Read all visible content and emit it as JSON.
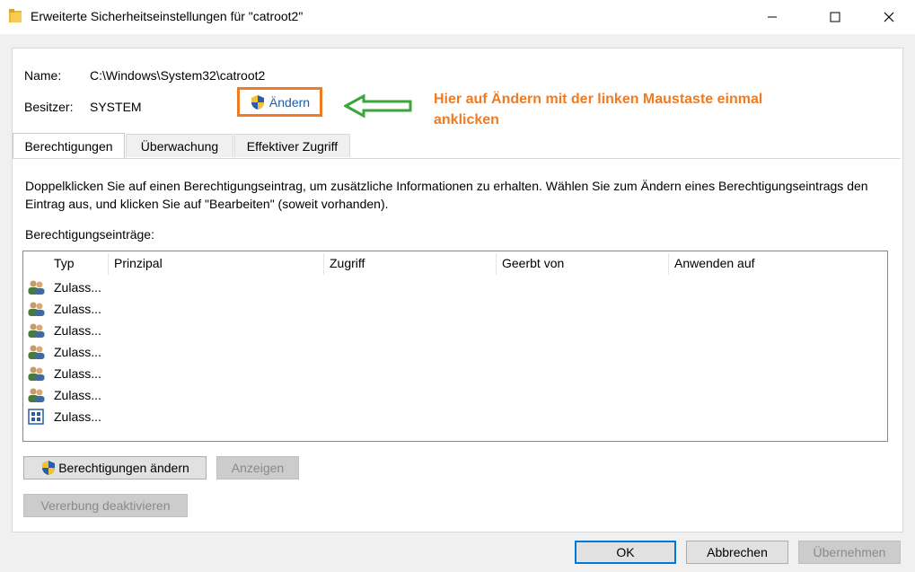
{
  "window": {
    "title": "Erweiterte Sicherheitseinstellungen für \"catroot2\"",
    "icons": [
      "folder-icon",
      "minimize-icon",
      "maximize-icon",
      "close-icon"
    ]
  },
  "owner_section": {
    "name_label": "Name:",
    "name_value": "C:\\Windows\\System32\\catroot2",
    "owner_label": "Besitzer:",
    "owner_value": "SYSTEM",
    "change_link": "Ändern"
  },
  "annotation": {
    "text": "Hier auf Ändern mit der linken Maustaste einmal anklicken",
    "color": "#f07b22",
    "arrow_color": "#3aa63a"
  },
  "tabs": [
    {
      "label": "Berechtigungen",
      "active": true
    },
    {
      "label": "Überwachung",
      "active": false
    },
    {
      "label": "Effektiver Zugriff",
      "active": false
    }
  ],
  "description": "Doppelklicken Sie auf einen Berechtigungseintrag, um zusätzliche Informationen zu erhalten. Wählen Sie zum Ändern eines Berechtigungseintrags den Eintrag aus, und klicken Sie auf \"Bearbeiten\" (soweit vorhanden).",
  "entries_label": "Berechtigungseinträge:",
  "table": {
    "columns": [
      "Typ",
      "Prinzipal",
      "Zugriff",
      "Geerbt von",
      "Anwenden auf"
    ],
    "rows": [
      {
        "icon": "users-icon",
        "typ": "Zulass..."
      },
      {
        "icon": "users-icon",
        "typ": "Zulass..."
      },
      {
        "icon": "users-icon",
        "typ": "Zulass..."
      },
      {
        "icon": "users-icon",
        "typ": "Zulass..."
      },
      {
        "icon": "users-icon",
        "typ": "Zulass..."
      },
      {
        "icon": "users-icon",
        "typ": "Zulass..."
      },
      {
        "icon": "app-package-icon",
        "typ": "Zulass..."
      }
    ]
  },
  "buttons": {
    "change_permissions": "Berechtigungen ändern",
    "show": "Anzeigen",
    "disable_inheritance": "Vererbung deaktivieren",
    "ok": "OK",
    "cancel": "Abbrechen",
    "apply": "Übernehmen"
  }
}
